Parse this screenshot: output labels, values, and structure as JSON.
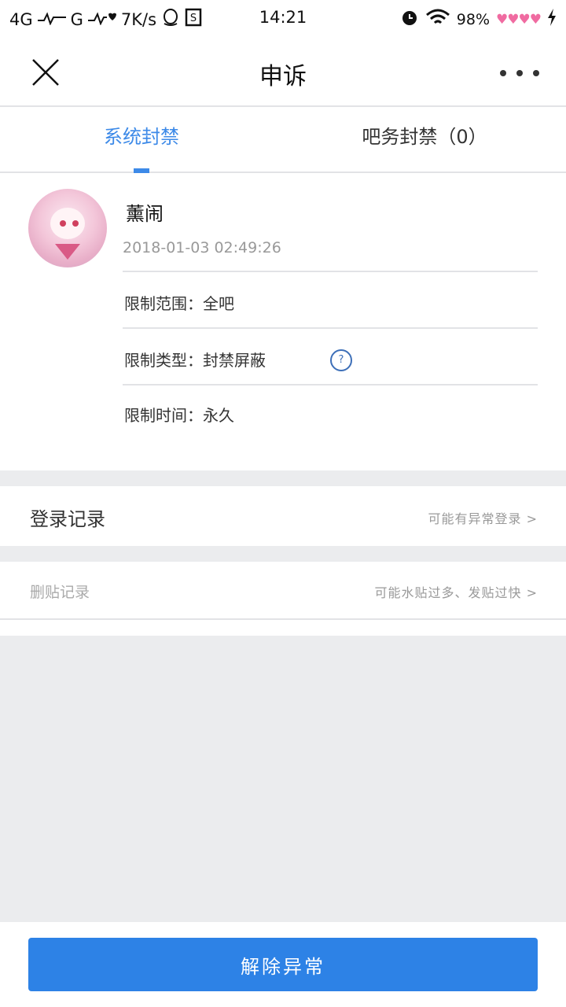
{
  "status_bar": {
    "network": "4G",
    "network2": "G",
    "speed": "7K/s",
    "time": "14:21",
    "battery": "98%",
    "hearts": "♥♥♥♥"
  },
  "header": {
    "title": "申诉"
  },
  "tabs": {
    "system_ban": "系统封禁",
    "bar_ban": "吧务封禁（0）",
    "active_color": "#3d8ae8"
  },
  "ban_card": {
    "username": "薰闹",
    "timestamp": "2018-01-03 02:49:26",
    "scope": "限制范围：全吧",
    "type": "限制类型：封禁屏蔽",
    "duration": "限制时间：永久",
    "help_symbol": "?"
  },
  "login_record": {
    "label": "登录记录",
    "hint": "可能有异常登录 >"
  },
  "delete_record": {
    "label": "删贴记录",
    "hint": "可能水贴过多、发贴过快 >"
  },
  "action": {
    "unblock_label": "解除异常",
    "button_color": "#2d82e6"
  }
}
